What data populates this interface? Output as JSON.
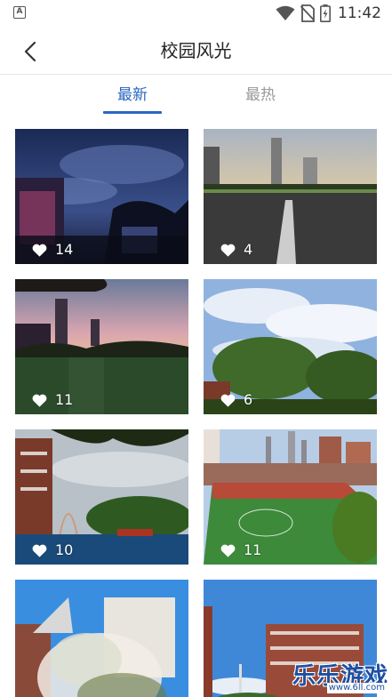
{
  "status_bar": {
    "time": "11:42",
    "app_icon_letter": "A",
    "icons": [
      "wifi-icon",
      "no-sim-icon",
      "battery-charging-icon"
    ]
  },
  "header": {
    "title": "校园风光",
    "back_icon": "chevron-left-icon"
  },
  "tabs": [
    {
      "label": "最新",
      "active": true
    },
    {
      "label": "最热",
      "active": false
    }
  ],
  "colors": {
    "accent": "#2a66c4",
    "inactive_tab": "#9a9a9a",
    "title_text": "#222222"
  },
  "photos": [
    {
      "likes": "14",
      "scene": "night campus sky"
    },
    {
      "likes": "4",
      "scene": "track at dusk"
    },
    {
      "likes": "11",
      "scene": "sunset field"
    },
    {
      "likes": "6",
      "scene": "tree and cloudy sky"
    },
    {
      "likes": "10",
      "scene": "rainbow over buildings"
    },
    {
      "likes": "11",
      "scene": "aerial football field"
    },
    {
      "likes": "",
      "scene": "blossoms and building"
    },
    {
      "likes": "",
      "scene": "brick building blue sky"
    }
  ],
  "watermark": {
    "title": "乐乐游戏",
    "url": "www.6ll.com"
  }
}
